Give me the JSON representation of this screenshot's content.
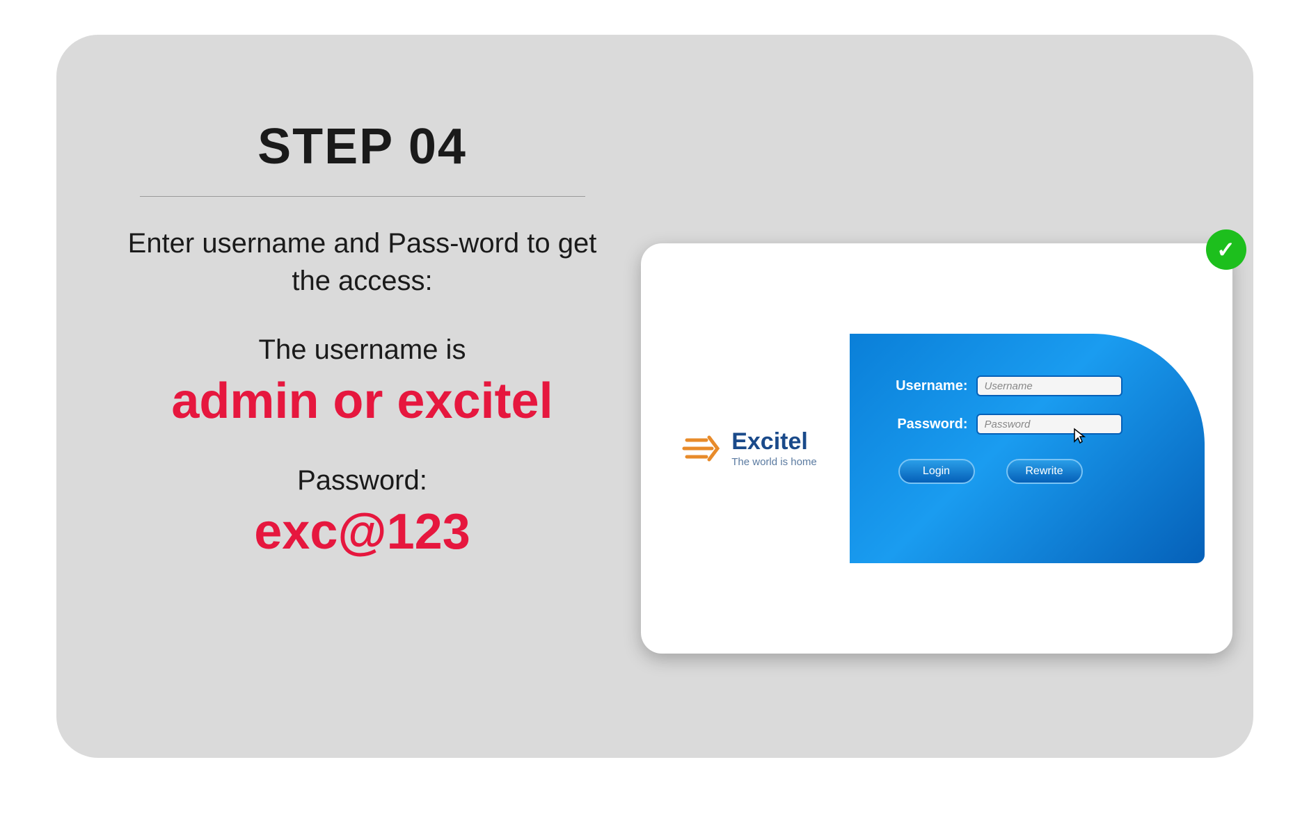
{
  "step": {
    "title": "STEP 04",
    "instruction": "Enter username and Pass-word to get the access:",
    "username_label": "The username is",
    "username_value": "admin or excitel",
    "password_label": "Password:",
    "password_value": "exc@123"
  },
  "login_panel": {
    "brand_name": "Excitel",
    "brand_tagline": "The world is home",
    "form": {
      "username_label": "Username:",
      "username_placeholder": "Username",
      "password_label": "Password:",
      "password_placeholder": "Password",
      "login_button": "Login",
      "rewrite_button": "Rewrite"
    }
  },
  "badge": {
    "check": "✓"
  }
}
